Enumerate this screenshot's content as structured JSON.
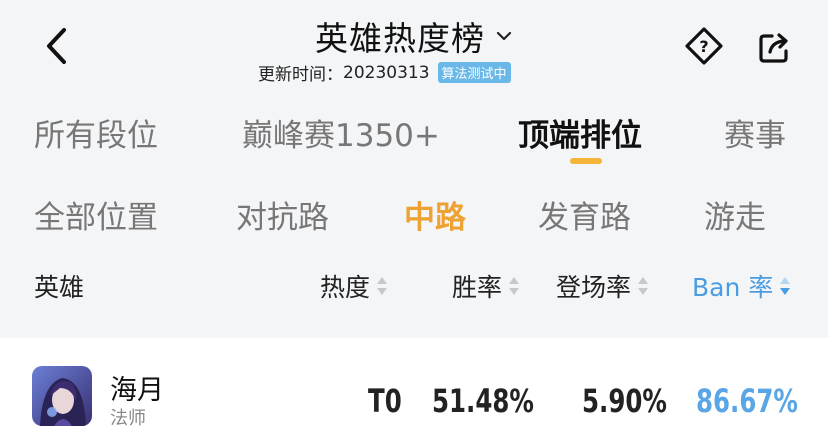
{
  "header": {
    "title": "英雄热度榜",
    "update_label": "更新时间：",
    "update_date": "20230313",
    "badge": "算法测试中"
  },
  "rank_tabs": [
    {
      "label": "所有段位",
      "active": false
    },
    {
      "label": "巅峰赛1350+",
      "active": false
    },
    {
      "label": "顶端排位",
      "active": true
    },
    {
      "label": "赛事",
      "active": false
    }
  ],
  "position_tabs": [
    {
      "label": "全部位置",
      "active": false
    },
    {
      "label": "对抗路",
      "active": false
    },
    {
      "label": "中路",
      "active": true
    },
    {
      "label": "发育路",
      "active": false
    },
    {
      "label": "游走",
      "active": false
    }
  ],
  "table": {
    "columns": [
      "英雄",
      "热度",
      "胜率",
      "登场率",
      "Ban 率"
    ],
    "sorted_column": "Ban 率",
    "rows": [
      {
        "name": "海月",
        "role": "法师",
        "tier": "T0",
        "win_rate": "51.48%",
        "pick_rate": "5.90%",
        "ban_rate": "86.67%"
      }
    ]
  },
  "colors": {
    "accent_orange": "#eda231",
    "accent_blue": "#4a9de0",
    "badge_blue": "#69b8e8"
  }
}
